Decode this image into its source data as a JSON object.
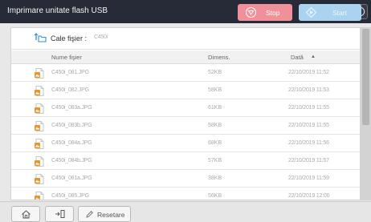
{
  "header": {
    "title": "Imprimare unitate flash USB",
    "icons": [
      "bell-icon",
      "usb-device-icon",
      "info-icon"
    ]
  },
  "path": {
    "label": "Cale fişier :",
    "value": "C450i"
  },
  "table": {
    "columns": {
      "name": "Nume fişier",
      "size": "Dimens.",
      "date": "Dată",
      "sort_indicator": "▲"
    },
    "rows": [
      {
        "name": "C450i_081.JPG",
        "size": "52KB",
        "date": "22/10/2019 11:52"
      },
      {
        "name": "C450i_082.JPG",
        "size": "58KB",
        "date": "22/10/2019 11:53"
      },
      {
        "name": "C450i_083a.JPG",
        "size": "61KB",
        "date": "22/10/2019 11:55"
      },
      {
        "name": "C450i_083b.JPG",
        "size": "58KB",
        "date": "22/10/2019 11:55"
      },
      {
        "name": "C450i_084a.JPG",
        "size": "68KB",
        "date": "22/10/2019 11:56"
      },
      {
        "name": "C450i_084b.JPG",
        "size": "57KB",
        "date": "22/10/2019 11:57"
      },
      {
        "name": "C450i_081a.JPG",
        "size": "38KB",
        "date": "22/10/2019 11:59"
      },
      {
        "name": "C450i_085.JPG",
        "size": "56KB",
        "date": "22/10/2019 12:00"
      }
    ]
  },
  "bottom": {
    "reset_label": "Resetare",
    "stop_label": "Stop",
    "start_label": "Start"
  },
  "colors": {
    "header_bg": "#272b38",
    "stop": "#f0919a",
    "start": "#a9d3ef",
    "path_icon": "#2c8fd8",
    "file_icon": "#e8952c"
  }
}
